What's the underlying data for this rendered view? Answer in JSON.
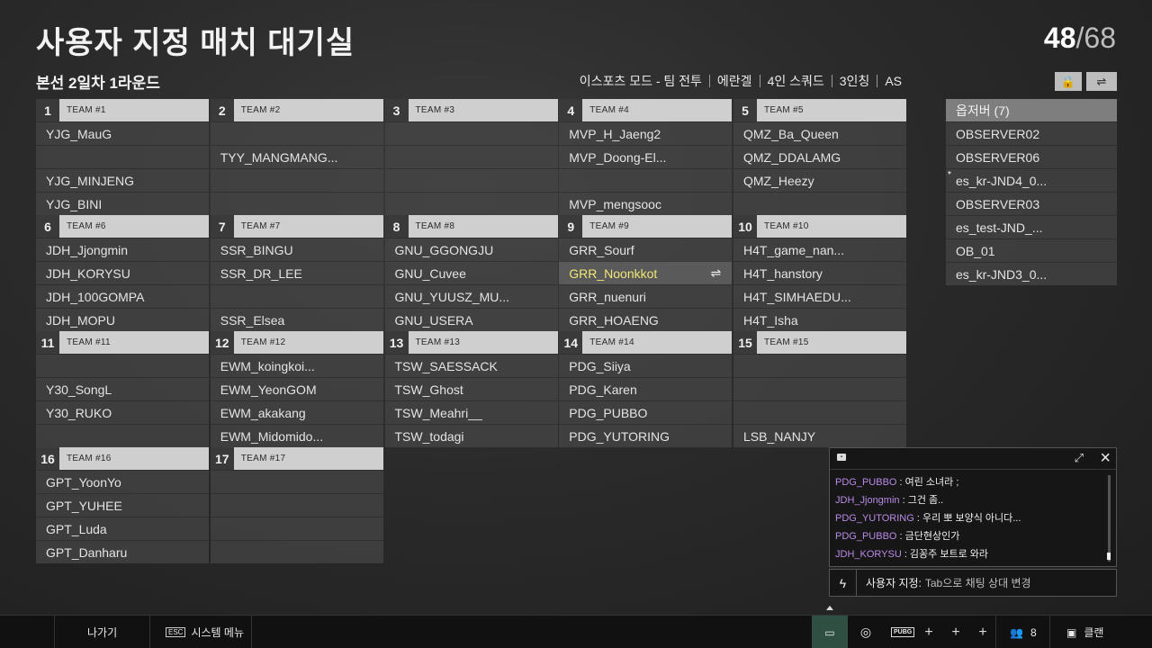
{
  "header": {
    "title": "사용자 지정 매치 대기실",
    "count": "48",
    "total": "/68",
    "round": "본선 2일차 1라운드",
    "modes": [
      "이스포츠 모드 - 팀 전투",
      "에란겔",
      "4인 스쿼드",
      "3인칭",
      "AS"
    ],
    "lock_icon": "lock-icon",
    "swap_icon": "swap-icon"
  },
  "teams": [
    {
      "num": "1",
      "label": "TEAM #1",
      "slots": [
        "YJG_MauG",
        "",
        "YJG_MINJENG",
        "YJG_BINI"
      ]
    },
    {
      "num": "2",
      "label": "TEAM #2",
      "slots": [
        "",
        "TYY_MANGMANG...",
        "",
        ""
      ]
    },
    {
      "num": "3",
      "label": "TEAM #3",
      "slots": [
        "",
        "",
        "",
        ""
      ]
    },
    {
      "num": "4",
      "label": "TEAM #4",
      "slots": [
        "MVP_H_Jaeng2",
        "MVP_Doong-El...",
        "",
        "MVP_mengsooc"
      ]
    },
    {
      "num": "5",
      "label": "TEAM #5",
      "slots": [
        "QMZ_Ba_Queen",
        "QMZ_DDALAMG",
        "QMZ_Heezy",
        ""
      ]
    },
    {
      "num": "6",
      "label": "TEAM #6",
      "slots": [
        "JDH_Jjongmin",
        "JDH_KORYSU",
        "JDH_100GOMPA",
        "JDH_MOPU"
      ]
    },
    {
      "num": "7",
      "label": "TEAM #7",
      "slots": [
        "SSR_BINGU",
        "SSR_DR_LEE",
        "",
        "SSR_Elsea"
      ]
    },
    {
      "num": "8",
      "label": "TEAM #8",
      "slots": [
        "GNU_GGONGJU",
        "GNU_Cuvee",
        "GNU_YUUSZ_MU...",
        "GNU_USERA"
      ]
    },
    {
      "num": "9",
      "label": "TEAM #9",
      "slots": [
        "GRR_Sourf",
        "GRR_Noonkkot",
        "GRR_nuenuri",
        "GRR_HOAENG"
      ],
      "highlight": 1
    },
    {
      "num": "10",
      "label": "TEAM #10",
      "slots": [
        "H4T_game_nan...",
        "H4T_hanstory",
        "H4T_SIMHAEDU...",
        "H4T_Isha"
      ]
    },
    {
      "num": "11",
      "label": "TEAM #11",
      "slots": [
        "",
        "Y30_SongL",
        "Y30_RUKO",
        ""
      ]
    },
    {
      "num": "12",
      "label": "TEAM #12",
      "slots": [
        "EWM_koingkoi...",
        "EWM_YeonGOM",
        "EWM_akakang",
        "EWM_Midomido..."
      ]
    },
    {
      "num": "13",
      "label": "TEAM #13",
      "slots": [
        "TSW_SAESSACK",
        "TSW_Ghost",
        "TSW_Meahri__",
        "TSW_todagi"
      ]
    },
    {
      "num": "14",
      "label": "TEAM #14",
      "slots": [
        "PDG_Siiya",
        "PDG_Karen",
        "PDG_PUBBO",
        "PDG_YUTORING"
      ]
    },
    {
      "num": "15",
      "label": "TEAM #15",
      "slots": [
        "",
        "",
        "",
        "LSB_NANJY"
      ]
    },
    {
      "num": "16",
      "label": "TEAM #16",
      "slots": [
        "GPT_YoonYo",
        "GPT_YUHEE",
        "GPT_Luda",
        "GPT_Danharu"
      ]
    },
    {
      "num": "17",
      "label": "TEAM #17",
      "slots": [
        "",
        "",
        "",
        ""
      ]
    }
  ],
  "observers": {
    "title": "옵저버 (7)",
    "items": [
      "OBSERVER02",
      "OBSERVER06",
      "es_kr-JND4_0...",
      "OBSERVER03",
      "es_test-JND_...",
      "OB_01",
      "es_kr-JND3_0..."
    ],
    "star_mark": "*"
  },
  "chat": {
    "lines": [
      {
        "who": "PDG_PUBBO",
        "msg": " : 여린 소녀라 ;"
      },
      {
        "who": "JDH_Jjongmin",
        "msg": " : 그건 좀.."
      },
      {
        "who": "PDG_YUTORING",
        "msg": " : 우리 뽀 보양식 아니다..."
      },
      {
        "who": "PDG_PUBBO",
        "msg": " : 금단현상인가"
      },
      {
        "who": "JDH_KORYSU",
        "msg": " : 김꽁주 보트로 와라"
      }
    ],
    "input_label": "사용자 지정:",
    "input_hint": "Tab으로 채팅 상대 변경"
  },
  "bottombar": {
    "exit": "나가기",
    "esc": "ESC",
    "system_menu": "시스템 메뉴",
    "pubg": "PUBG",
    "friends_count": "8",
    "clan": "클랜"
  }
}
